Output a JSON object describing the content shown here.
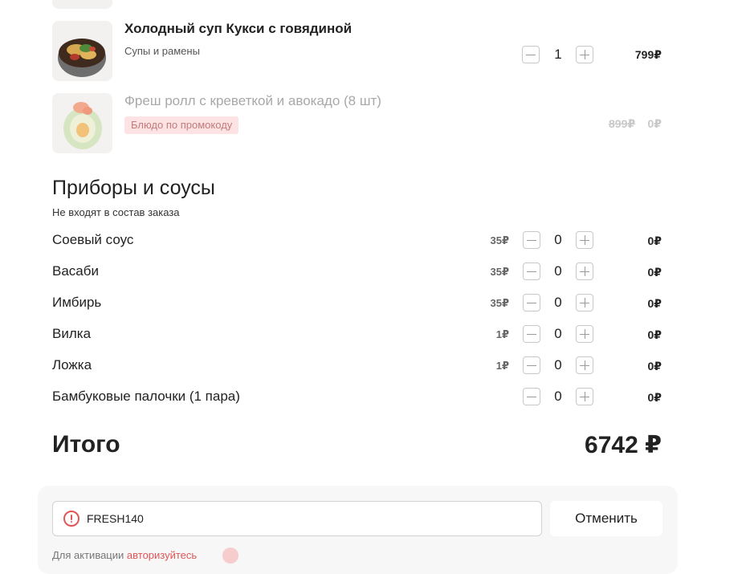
{
  "cart": {
    "items": [
      {
        "title": "Холодный суп Кукси с говядиной",
        "category": "Супы и рамены",
        "quantity": "1",
        "price": "799₽"
      },
      {
        "title": "Фреш ролл с креветкой и авокадо (8 шт)",
        "badge": "Блюдо по промокоду",
        "old_price": "899₽",
        "price": "0₽"
      }
    ]
  },
  "accessories": {
    "title": "Приборы и соусы",
    "subtitle": "Не входят в состав заказа",
    "items": [
      {
        "name": "Соевый соус",
        "unit_price": "35₽",
        "quantity": "0",
        "total": "0₽"
      },
      {
        "name": "Васаби",
        "unit_price": "35₽",
        "quantity": "0",
        "total": "0₽"
      },
      {
        "name": "Имбирь",
        "unit_price": "35₽",
        "quantity": "0",
        "total": "0₽"
      },
      {
        "name": "Вилка",
        "unit_price": "1₽",
        "quantity": "0",
        "total": "0₽"
      },
      {
        "name": "Ложка",
        "unit_price": "1₽",
        "quantity": "0",
        "total": "0₽"
      },
      {
        "name": "Бамбуковые палочки (1 пара)",
        "unit_price": "",
        "quantity": "0",
        "total": "0₽"
      }
    ]
  },
  "total": {
    "label": "Итого",
    "value": "6742 ₽"
  },
  "promo": {
    "code": "FRESH140",
    "cancel_label": "Отменить",
    "note_prefix": "Для активации ",
    "note_link": "авторизуйтесь"
  },
  "colors": {
    "accent": "#e05656",
    "badge_bg": "#fde3e3",
    "panel_bg": "#f7f7f7"
  }
}
